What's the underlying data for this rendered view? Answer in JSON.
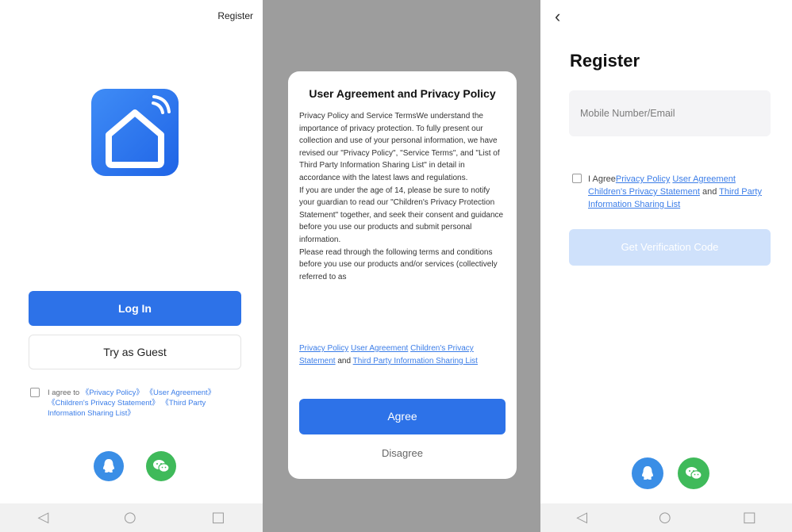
{
  "screen1": {
    "register_link": "Register",
    "login_label": "Log In",
    "guest_label": "Try as Guest",
    "agree_prefix": "I agree to",
    "links": [
      "《Privacy Policy》",
      "《User Agreement》",
      "《Children's Privacy Statement》",
      "《Third Party Information Sharing List》"
    ],
    "social": [
      "qq-icon",
      "wechat-icon"
    ]
  },
  "screen2": {
    "title": "User Agreement and Privacy Policy",
    "body": [
      "Privacy Policy and Service TermsWe understand the importance of privacy protection. To fully present our collection and use of your personal information, we have revised our \"Privacy Policy\", \"Service Terms\", and \"List of Third Party Information Sharing List\" in detail in accordance with the latest laws and regulations.",
      "If you are under the age of 14, please be sure to notify your guardian to read our \"Children's Privacy Protection Statement\" together, and seek their consent and guidance before you use our products and submit personal information.",
      "Please read through the following terms and conditions before you use our products and/or services (collectively referred to as"
    ],
    "links": [
      "Privacy Policy",
      "User Agreement",
      "Children's Privacy Statement",
      "Third Party Information Sharing List"
    ],
    "and": "and",
    "agree_label": "Agree",
    "disagree_label": "Disagree"
  },
  "screen3": {
    "back": "‹",
    "title": "Register",
    "input_placeholder": "Mobile Number/Email",
    "agree_prefix": "I Agree",
    "links": [
      "Privacy Policy",
      "User Agreement",
      "Children's Privacy Statement",
      "Third Party Information Sharing List"
    ],
    "and": "and",
    "verify_label": "Get Verification Code",
    "social": [
      "qq-icon",
      "wechat-icon"
    ]
  },
  "navbar": {
    "back": "◁",
    "home": "○",
    "recent": "□"
  },
  "colors": {
    "primary": "#2d72e8",
    "qq": "#3a8ee6",
    "wechat": "#3fba5a",
    "disabled": "#cfe1fb",
    "overlay": "#9d9d9d"
  }
}
